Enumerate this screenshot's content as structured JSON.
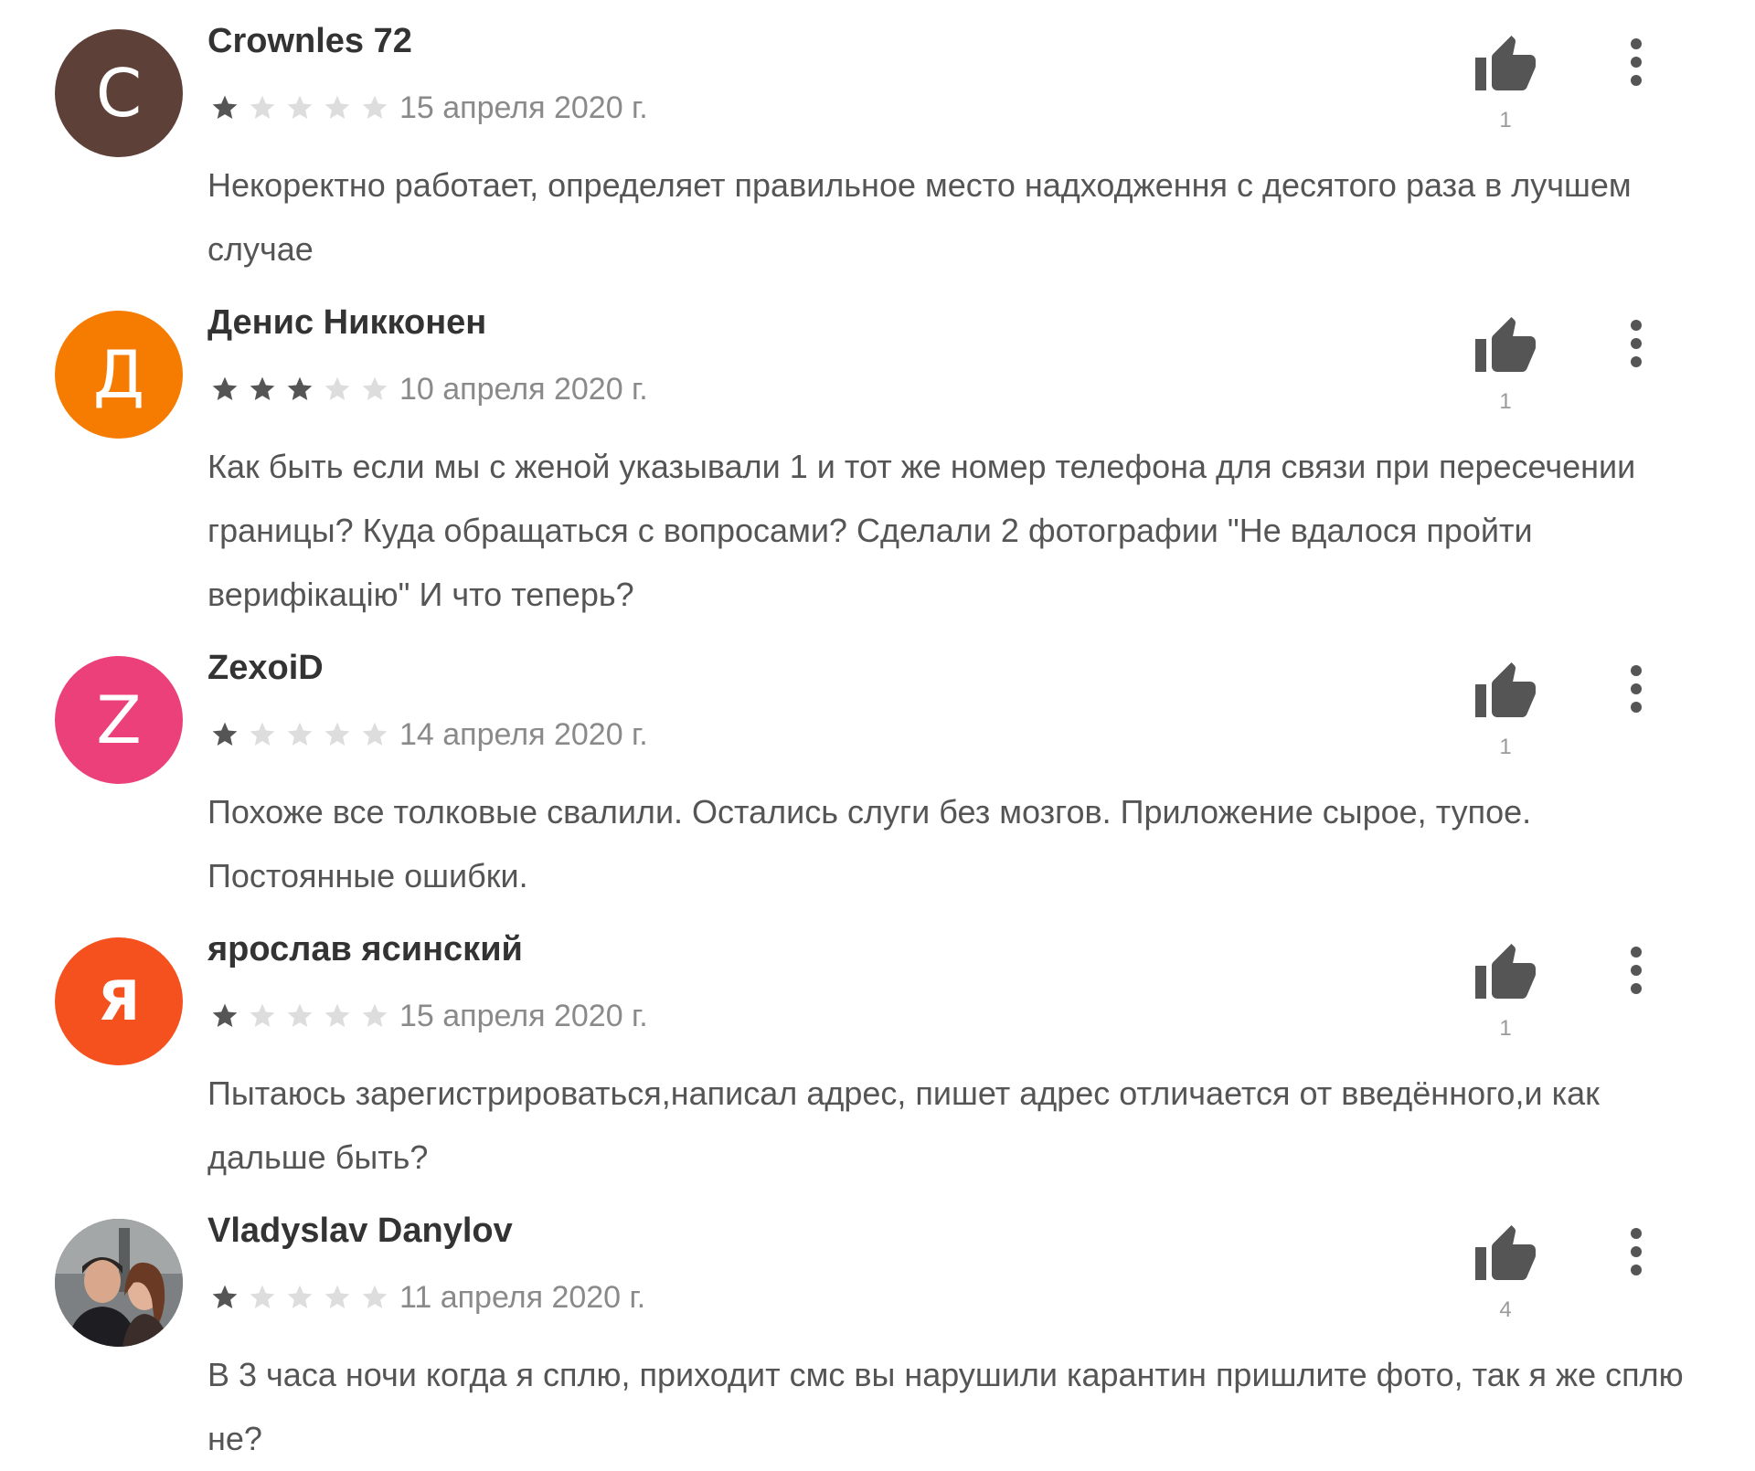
{
  "colors": {
    "star_filled": "#555555",
    "star_empty": "#dddddd",
    "icon": "#555555"
  },
  "reviews": [
    {
      "author": "Crownles 72",
      "avatar_letter": "C",
      "avatar_color": "#5d4037",
      "rating": 1,
      "date": "15 апреля 2020 г.",
      "likes": "1",
      "text": "Некоректно работает, определяет правильное место надходження с десятого раза в лучшем случае",
      "like_icon": "thumb-up-icon",
      "menu_icon": "more-vert-icon"
    },
    {
      "author": "Денис Никконен",
      "avatar_letter": "Д",
      "avatar_color": "#f57c00",
      "rating": 3,
      "date": "10 апреля 2020 г.",
      "likes": "1",
      "text": "Как быть если мы с женой указывали 1 и тот же номер телефона для связи при пересечении границы? Куда обращаться с вопросами? Сделали 2 фотографии \"Не вдалося пройти верифікацію\" И что теперь?",
      "like_icon": "thumb-up-icon",
      "menu_icon": "more-vert-icon"
    },
    {
      "author": "ZexoiD",
      "avatar_letter": "Z",
      "avatar_color": "#ec407a",
      "rating": 1,
      "date": "14 апреля 2020 г.",
      "likes": "1",
      "text": "Похоже все толковые свалили. Остались слуги без мозгов. Приложение сырое, тупое. Постоянные ошибки.",
      "like_icon": "thumb-up-icon",
      "menu_icon": "more-vert-icon"
    },
    {
      "author": "ярослав ясинский",
      "avatar_letter": "Я",
      "avatar_color": "#f4511e",
      "rating": 1,
      "date": "15 апреля 2020 г.",
      "likes": "1",
      "text": "Пытаюсь зарегистрироваться,написал адрес, пишет адрес отличается от введённого,и как дальше быть?",
      "like_icon": "thumb-up-icon",
      "menu_icon": "more-vert-icon"
    },
    {
      "author": "Vladyslav Danylov",
      "avatar_letter": "",
      "avatar_color": "#6b6e70",
      "rating": 1,
      "date": "11 апреля 2020 г.",
      "likes": "4",
      "text": "В 3 часа ночи когда я сплю, приходит смс вы нарушили карантин пришлите фото, так я же сплю не?",
      "like_icon": "thumb-up-icon",
      "menu_icon": "more-vert-icon"
    }
  ]
}
